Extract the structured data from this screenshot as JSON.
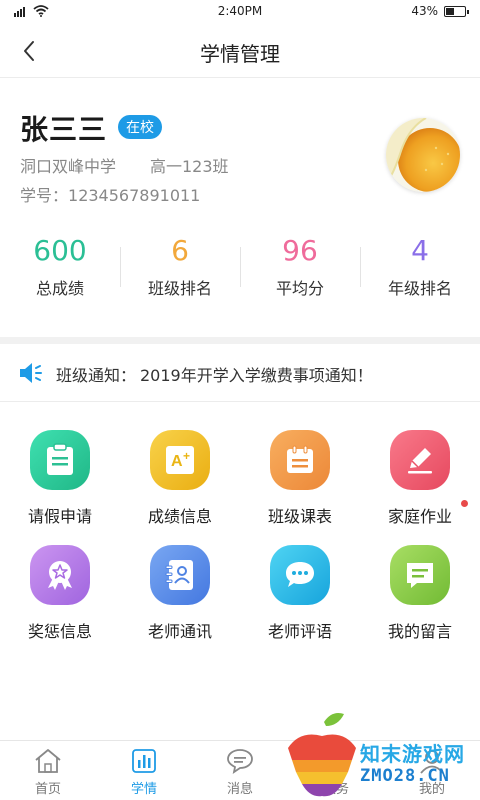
{
  "status_bar": {
    "time": "2:40PM",
    "battery": "43%",
    "battery_level": 0.43
  },
  "header": {
    "title": "学情管理"
  },
  "profile": {
    "name": "张三三",
    "status": "在校",
    "school": "洞口双峰中学",
    "class": "高一123班",
    "student_id_label": "学号：",
    "student_id": "1234567891011"
  },
  "stats": [
    {
      "value": "600",
      "label": "总成绩",
      "color": "#2bbf95"
    },
    {
      "value": "6",
      "label": "班级排名",
      "color": "#f2a83b"
    },
    {
      "value": "96",
      "label": "平均分",
      "color": "#ef6b9b"
    },
    {
      "value": "4",
      "label": "年级排名",
      "color": "#8a6ee8"
    }
  ],
  "notice": {
    "label": "班级通知：",
    "text": "2019年开学入学缴费事项通知！"
  },
  "grid": [
    {
      "label": "请假申请",
      "icon": "clipboard-icon",
      "color": "#2dc99a"
    },
    {
      "label": "成绩信息",
      "icon": "grade-a-plus-icon",
      "color": "#f2c12e"
    },
    {
      "label": "班级课表",
      "icon": "calendar-icon",
      "color": "#f2994a"
    },
    {
      "label": "家庭作业",
      "icon": "pencil-icon",
      "color": "#f0647a"
    },
    {
      "label": "奖惩信息",
      "icon": "award-ribbon-icon",
      "color": "#b77ce8"
    },
    {
      "label": "老师通讯",
      "icon": "contact-book-icon",
      "color": "#5b8fe6"
    },
    {
      "label": "老师评语",
      "icon": "chat-bubble-icon",
      "color": "#23b5e8"
    },
    {
      "label": "我的留言",
      "icon": "message-icon",
      "color": "#8ccf4a"
    }
  ],
  "bottom_nav": [
    {
      "label": "首页",
      "icon": "home-icon"
    },
    {
      "label": "学情",
      "icon": "chart-icon"
    },
    {
      "label": "消息",
      "icon": "message-bubble-icon"
    },
    {
      "label": "校务",
      "icon": "document-icon"
    },
    {
      "label": "我的",
      "icon": "user-icon"
    }
  ],
  "watermark": {
    "line1": "知末游戏网",
    "line2": "ZMO28.CN"
  },
  "colors": {
    "accent": "#1e9be6"
  }
}
